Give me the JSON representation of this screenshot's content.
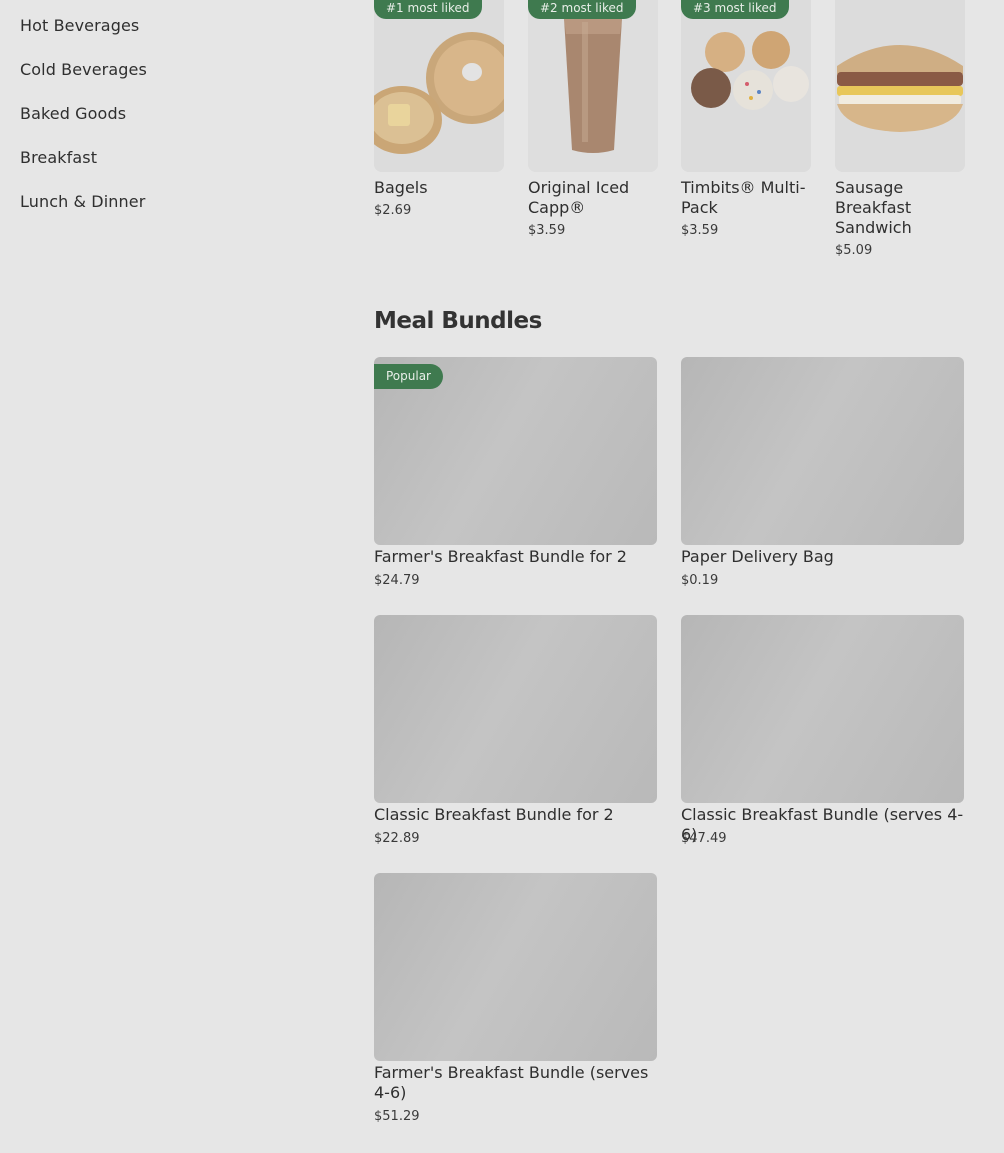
{
  "sidebar": {
    "items": [
      {
        "label": "Hot Beverages"
      },
      {
        "label": "Cold Beverages"
      },
      {
        "label": "Baked Goods"
      },
      {
        "label": "Breakfast"
      },
      {
        "label": "Lunch & Dinner"
      }
    ]
  },
  "top_items": [
    {
      "badge": "#1 most liked",
      "name": "Bagels",
      "price": "$2.69"
    },
    {
      "badge": "#2 most liked",
      "name": "Original Iced Capp®",
      "price": "$3.59"
    },
    {
      "badge": "#3 most liked",
      "name": "Timbits® Multi-Pack",
      "price": "$3.59"
    },
    {
      "badge": "",
      "name": "Sausage Breakfast Sandwich",
      "price": "$5.09"
    }
  ],
  "meal_bundles": {
    "title": "Meal Bundles",
    "items": [
      {
        "badge": "Popular",
        "name": "Farmer's Breakfast Bundle for 2",
        "price": "$24.79"
      },
      {
        "badge": "",
        "name": "Paper Delivery Bag",
        "price": "$0.19"
      },
      {
        "badge": "",
        "name": "Classic Breakfast Bundle for 2",
        "price": "$22.89"
      },
      {
        "badge": "",
        "name": "Classic Breakfast Bundle (serves 4-6)",
        "price": "$47.49"
      },
      {
        "badge": "",
        "name": "Farmer's Breakfast Bundle (serves 4-6)",
        "price": "$51.29"
      }
    ]
  },
  "colors": {
    "badge_green": "#3f7a4f",
    "page_background": "#e6e6e6"
  }
}
